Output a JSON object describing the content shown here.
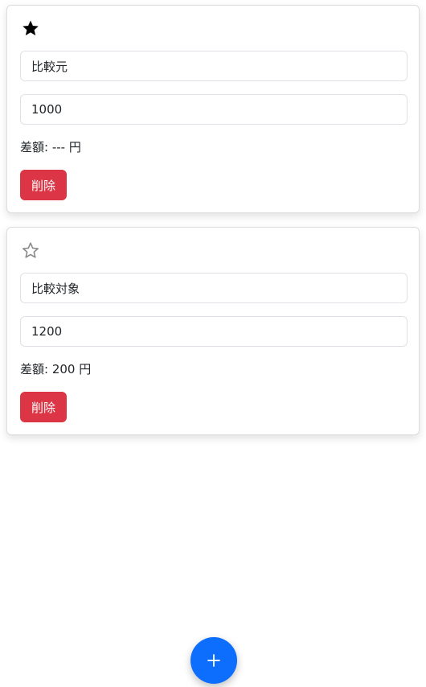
{
  "colors": {
    "primary": "#0d6efd",
    "danger": "#dc3545",
    "star_filled": "#000000",
    "star_outline": "#8a8a8a"
  },
  "items": [
    {
      "favorite": true,
      "star_icon": "star-filled-icon",
      "name": "比較元",
      "price": "1000",
      "diff_text": "差額: --- 円",
      "delete_label": "削除"
    },
    {
      "favorite": false,
      "star_icon": "star-outline-icon",
      "name": "比較対象",
      "price": "1200",
      "diff_text": "差額: 200 円",
      "delete_label": "削除"
    }
  ],
  "fab": {
    "icon": "plus-icon"
  }
}
